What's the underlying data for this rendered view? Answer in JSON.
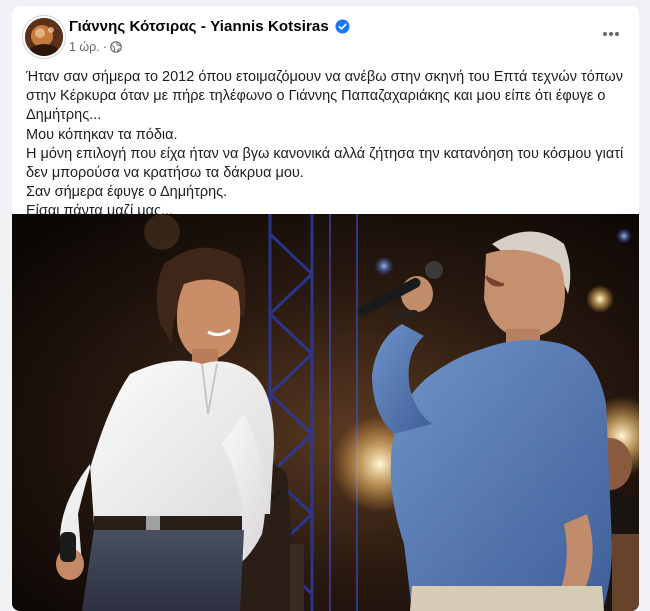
{
  "post": {
    "author": "Γιάννης Κότσιρας - Yiannis Kotsiras",
    "time": "1 ώρ.",
    "separator": "·",
    "text_lines": [
      "Ήταν σαν σήμερα το 2012 όπου ετοιμαζόμουν να ανέβω στην σκηνή του Επτά τεχνών τόπων",
      "στην Κέρκυρα όταν με πήρε τηλέφωνο ο Γιάννης Παπαζαχαριάκης και μου είπε ότι έφυγε ο",
      "Δημήτρης...",
      "Μου κόπηκαν τα πόδια.",
      "Η μόνη επιλογή που είχα ήταν να βγω κανονικά αλλά ζήτησα την κατανόηση του κόσμου γιατί",
      "δεν μπορούσα να κρατήσω τα δάκρυα μου.",
      "Σαν σήμερα έφυγε ο Δημήτρης.",
      "Είσαι πάντα μαζί μας..."
    ]
  },
  "icons": {
    "verified": "verified-badge-icon",
    "audience": "globe-icon",
    "more": "more-options-icon"
  },
  "colors": {
    "verified_blue": "#1877f2",
    "text": "#1c1e21",
    "meta": "#65676b"
  }
}
